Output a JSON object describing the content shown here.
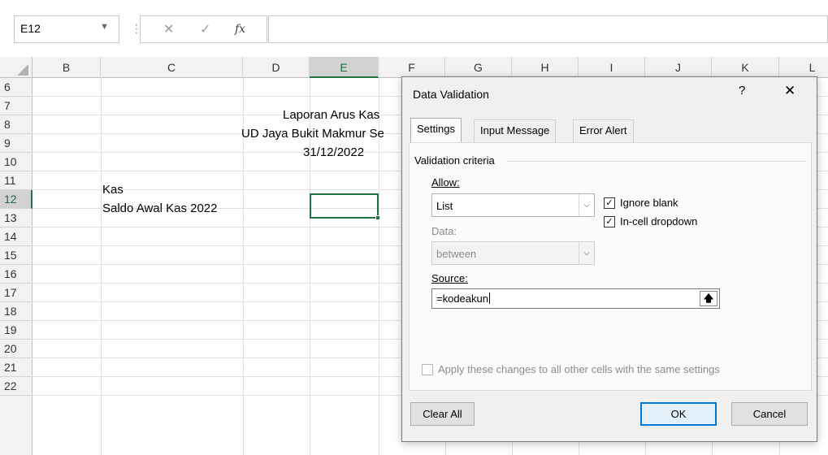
{
  "formula_bar": {
    "name_box": "E12",
    "name_box_arrow": "▼",
    "divider": "⋮",
    "cancel_icon": "✕",
    "enter_icon": "✓",
    "fx_label": "fx",
    "formula": ""
  },
  "sheet": {
    "columns": [
      "B",
      "C",
      "D",
      "E",
      "F",
      "G",
      "H",
      "I",
      "J",
      "K",
      "L"
    ],
    "selected_column": "E",
    "rows": [
      "6",
      "7",
      "8",
      "9",
      "10",
      "11",
      "12",
      "13",
      "14",
      "15",
      "16",
      "17",
      "18",
      "19",
      "20",
      "21",
      "22"
    ],
    "selected_row": "12",
    "cells": {
      "title": "Laporan Arus Kas",
      "company": "UD Jaya Bukit Makmur Se",
      "date": "31/12/2022",
      "c11": "Kas",
      "c12": "Saldo Awal Kas 2022"
    },
    "active_cell": "E12"
  },
  "dialog": {
    "title": "Data Validation",
    "help": "?",
    "close": "✕",
    "tabs": [
      "Settings",
      "Input Message",
      "Error Alert"
    ],
    "active_tab": "Settings",
    "validation_criteria": "Validation criteria",
    "allow_label": "Allow:",
    "allow_value": "List",
    "data_label": "Data:",
    "data_value": "between",
    "ignore_blank": {
      "label": "Ignore blank",
      "checked": true
    },
    "in_cell_dropdown": {
      "label": "In-cell dropdown",
      "checked": true
    },
    "source_label": "Source:",
    "source_value": "=kodeakun",
    "apply_all": {
      "label": "Apply these changes to all other cells with the same settings",
      "checked": false,
      "disabled": true
    },
    "buttons": {
      "clear_all": "Clear All",
      "ok": "OK",
      "cancel": "Cancel"
    }
  },
  "colors": {
    "excel_green": "#217346",
    "ok_border": "#0078d7"
  }
}
